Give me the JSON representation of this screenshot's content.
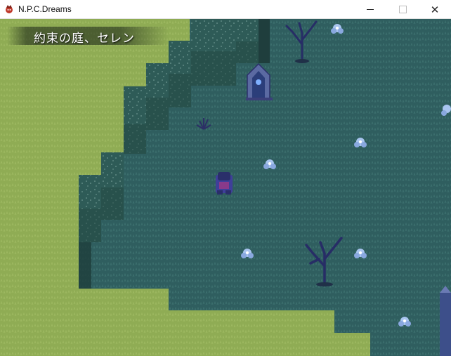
{
  "window": {
    "title": "N.P.C.Dreams",
    "app_icon": "game-app-icon",
    "controls": {
      "minimize": "minimize-icon",
      "maximize": "maximize-icon",
      "close": "close-icon",
      "close_glyph": "✕"
    }
  },
  "map": {
    "name": "約束の庭、セレン"
  },
  "colors": {
    "grass_light": "#8fac54",
    "grass_dark": "#2f5e5f",
    "cliff": "#2f5e58",
    "flower": "#a8c4ef",
    "tree": "#2a2f6a"
  }
}
